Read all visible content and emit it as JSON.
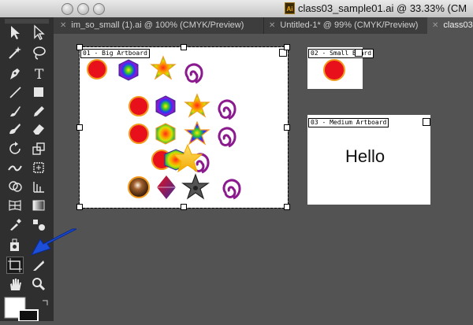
{
  "window": {
    "title": "class03_sample01.ai @ 33.33% (CM",
    "file_icon_text": "Ai"
  },
  "tabs": [
    {
      "label": "im_so_small (1).ai @ 100% (CMYK/Preview)",
      "active": false
    },
    {
      "label": "Untitled-1* @ 99% (CMYK/Preview)",
      "active": false
    },
    {
      "label": "class03",
      "active": true
    }
  ],
  "artboards": [
    {
      "label": "01 - Big Artboard",
      "selected": true
    },
    {
      "label": "02 - Small Board",
      "selected": false
    },
    {
      "label": "03 - Medium Artboard",
      "selected": false,
      "text": "Hello"
    }
  ],
  "tools": [
    "selection-tool",
    "direct-selection-tool",
    "magic-wand-tool",
    "lasso-tool",
    "pen-tool",
    "type-tool",
    "line-segment-tool",
    "rectangle-tool",
    "paintbrush-tool",
    "pencil-tool",
    "blob-brush-tool",
    "eraser-tool",
    "rotate-tool",
    "scale-tool",
    "width-tool",
    "free-transform-tool",
    "shape-builder-tool",
    "perspective-grid-tool",
    "symbol-sprayer-tool",
    "column-graph-tool",
    "mesh-tool",
    "gradient-tool",
    "eyedropper-tool",
    "blend-tool",
    "live-paint-tool",
    "artboard-tool",
    "slice-tool",
    "hand-tool",
    "zoom-tool"
  ],
  "annotation": {
    "type": "arrow",
    "color": "#1c4ed8",
    "points_to": "artboard-tool"
  },
  "colors": {
    "canvas": "#535353",
    "toolbar": "#2f2f2f",
    "red": "#e8101a",
    "orange_stroke": "#f39a1e",
    "purple": "#8b1a8f"
  }
}
